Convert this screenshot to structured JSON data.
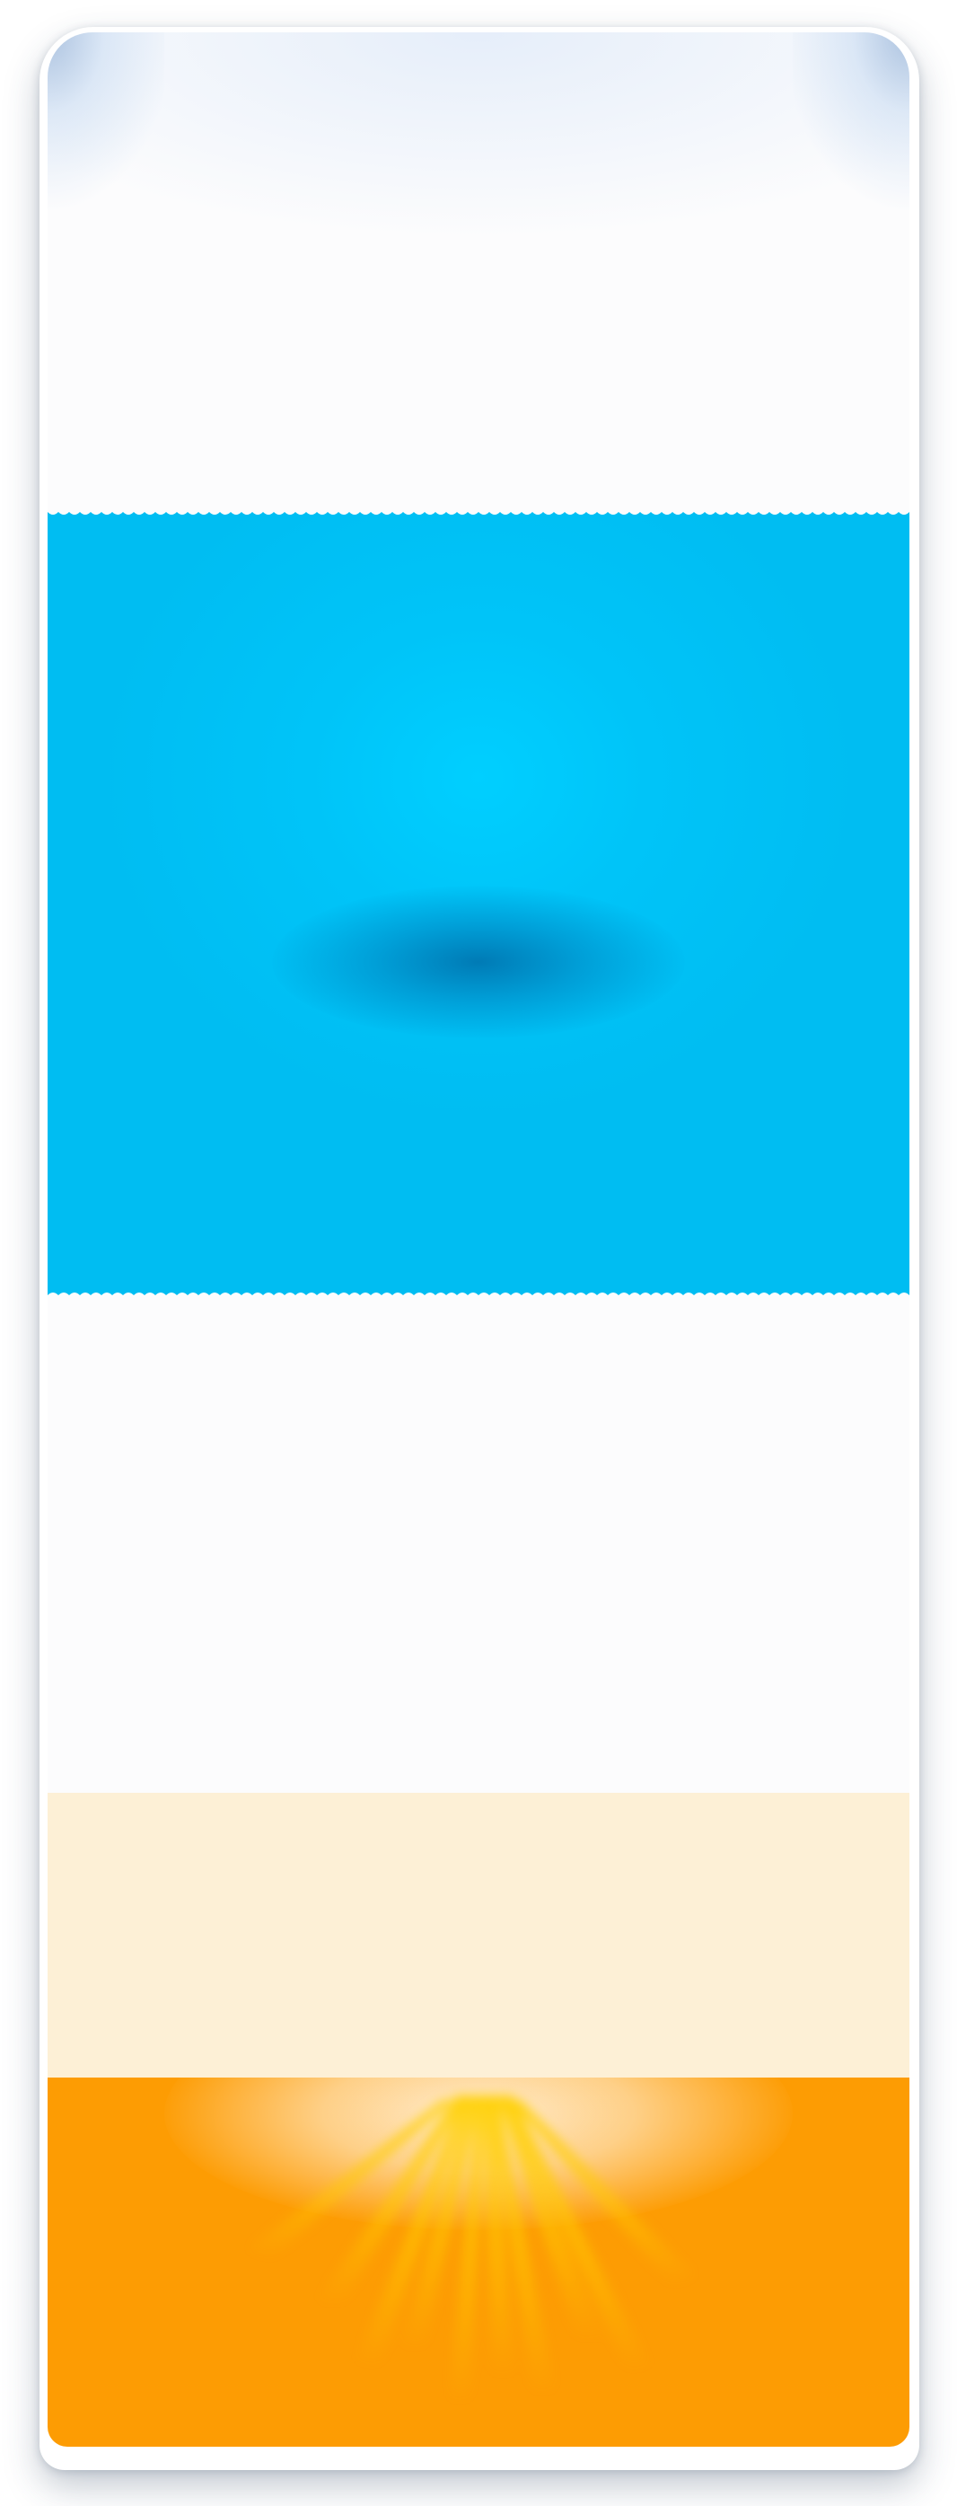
{
  "colors": {
    "page_background": "#ffffff",
    "card_background": "#fcfcfd",
    "sky_blue": "#00bdf2",
    "sky_blue_light": "#00cfff",
    "cream": "#fdf0d6",
    "orange": "#fd9c03",
    "ray_yellow": "#ffd000"
  },
  "sections": [
    "top-blank",
    "blue-panel",
    "middle-blank",
    "cream-strip",
    "orange-sunburst"
  ]
}
